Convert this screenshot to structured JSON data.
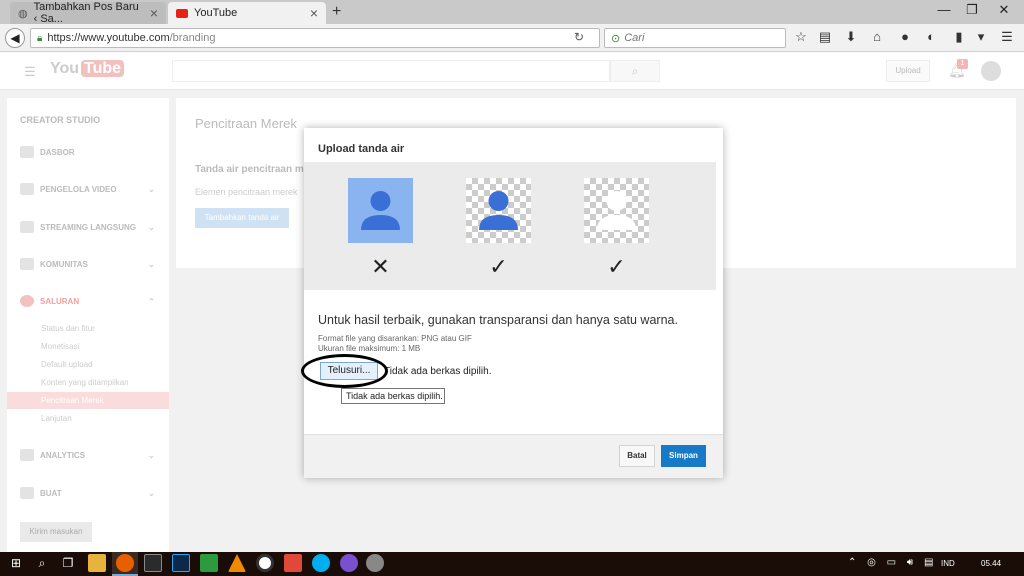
{
  "browser": {
    "tabs": [
      {
        "title": "Tambahkan Pos Baru ‹ Sa...",
        "active": false
      },
      {
        "title": "YouTube",
        "active": true
      }
    ],
    "new_tab": "+",
    "url_host": "https://www.youtube.com",
    "url_path": "/branding",
    "search_placeholder": "Cari",
    "window_controls": {
      "minimize": "—",
      "restore": "❐",
      "close": "✕"
    }
  },
  "youtube": {
    "logo": "You",
    "logo_tube": "Tube",
    "upload_label": "Upload",
    "notification_count": "1",
    "sidebar": {
      "header": "CREATOR STUDIO",
      "items": [
        {
          "label": "DASBOR"
        },
        {
          "label": "PENGELOLA VIDEO"
        },
        {
          "label": "STREAMING LANGSUNG"
        },
        {
          "label": "KOMUNITAS"
        },
        {
          "label": "SALURAN"
        },
        {
          "label": "ANALYTICS"
        },
        {
          "label": "BUAT"
        }
      ],
      "subitems": [
        "Status dan fitur",
        "Monetisasi",
        "Default upload",
        "Konten yang ditampilkan",
        "Pencitraan Merek",
        "Lanjutan"
      ],
      "feedback_button": "Kirim masukan"
    },
    "main": {
      "title": "Pencitraan Merek",
      "section_title": "Tanda air pencitraan m",
      "section_text": "Elemen pencitraan merek",
      "add_button": "Tambahkan tanda air"
    }
  },
  "dialog": {
    "title": "Upload tanda air",
    "marks": [
      "✕",
      "✓",
      "✓"
    ],
    "hint": "Untuk hasil terbaik, gunakan transparansi dan hanya satu warna.",
    "format": "Format file yang disarankan: PNG atau GIF",
    "max_size": "Ukuran file maksimum: 1 MB",
    "browse_button": "Telusuri...",
    "no_file": "Tidak ada berkas dipilih.",
    "tooltip": "Tidak ada berkas dipilih.",
    "cancel_button": "Batal",
    "save_button": "Simpan"
  },
  "taskbar": {
    "language": "IND",
    "time": "05.44"
  },
  "colors": {
    "accent": "#167ac6",
    "preview_blue": "#8ab4f0",
    "figure_blue": "#3a6fd6"
  }
}
